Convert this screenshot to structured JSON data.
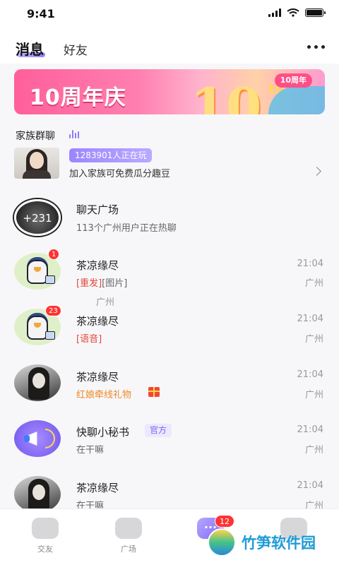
{
  "status_bar": {
    "time": "9:41"
  },
  "header": {
    "tab_messages": "消息",
    "tab_friends": "好友"
  },
  "banner": {
    "title": "10周年庆",
    "big_number": "10",
    "suffix": "th",
    "badge": "10周年"
  },
  "family_group": {
    "section_title": "家族群聊",
    "online": "1283901人正在玩",
    "description": "加入家族可免费瓜分趣豆"
  },
  "chat_square": {
    "count": "+231",
    "name": "聊天广场",
    "subtitle": "113个广州用户正在热聊"
  },
  "conversations": [
    {
      "name": "茶凉缘尽",
      "tag1": "[重发]",
      "tag2": "[图片]",
      "time": "21:04",
      "location": "广州",
      "extra_location": "广州",
      "badge": "1"
    },
    {
      "name": "茶凉缘尽",
      "tag1": "[语音]",
      "time": "21:04",
      "location": "广州",
      "badge": "23"
    },
    {
      "name": "茶凉缘尽",
      "message": "红娘牵线礼物",
      "time": "21:04",
      "location": "广州"
    },
    {
      "name": "快聊小秘书",
      "official": "官方",
      "message": "在干嘛",
      "time": "21:04",
      "location": "广州"
    },
    {
      "name": "茶凉缘尽",
      "message": "在干嘛",
      "time": "21:04",
      "location": "广州"
    }
  ],
  "bottom_nav": {
    "items": [
      {
        "label": "交友"
      },
      {
        "label": "广场"
      },
      {
        "label": ""
      },
      {
        "label": ""
      }
    ],
    "message_badge": "12"
  },
  "watermark": {
    "text": "竹笋软件园"
  }
}
